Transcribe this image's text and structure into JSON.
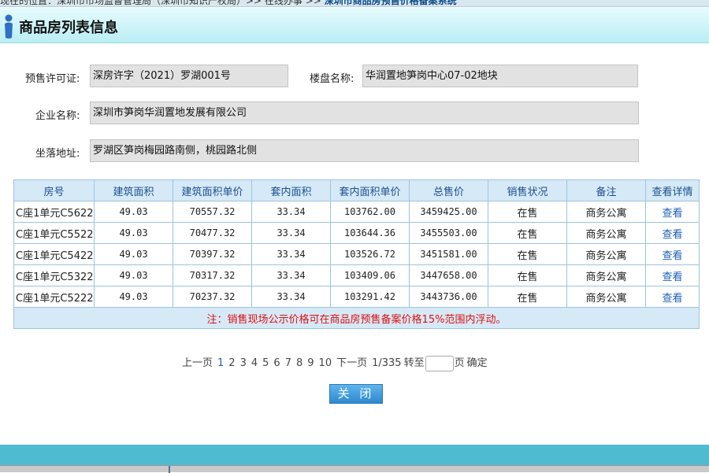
{
  "breadcrumb": {
    "prefix": "现在的位置：深圳市市场监督管理局（深圳市知识产权局）>> 在线办事 >> ",
    "current": "深圳市商品房预售价格备案系统"
  },
  "header": {
    "title": "商品房列表信息"
  },
  "form": {
    "permit_label": "预售许可证:",
    "permit_value": "深房许字（2021）罗湖001号",
    "project_label": "楼盘名称:",
    "project_value": "华润置地笋岗中心07-02地块",
    "company_label": "企业名称:",
    "company_value": "深圳市笋岗华润置地发展有限公司",
    "address_label": "坐落地址:",
    "address_value": "罗湖区笋岗梅园路南侧，桃园路北侧"
  },
  "table": {
    "columns": [
      "房号",
      "建筑面积",
      "建筑面积单价",
      "套内面积",
      "套内面积单价",
      "总售价",
      "销售状况",
      "备注",
      "查看详情"
    ],
    "rows": [
      [
        "C座1单元C5622",
        "49.03",
        "70557.32",
        "33.34",
        "103762.00",
        "3459425.00",
        "在售",
        "商务公寓",
        "查看"
      ],
      [
        "C座1单元C5522",
        "49.03",
        "70477.32",
        "33.34",
        "103644.36",
        "3455503.00",
        "在售",
        "商务公寓",
        "查看"
      ],
      [
        "C座1单元C5422",
        "49.03",
        "70397.32",
        "33.34",
        "103526.72",
        "3451581.00",
        "在售",
        "商务公寓",
        "查看"
      ],
      [
        "C座1单元C5322",
        "49.03",
        "70317.32",
        "33.34",
        "103409.06",
        "3447658.00",
        "在售",
        "商务公寓",
        "查看"
      ],
      [
        "C座1单元C5222",
        "49.03",
        "70237.32",
        "33.34",
        "103291.42",
        "3443736.00",
        "在售",
        "商务公寓",
        "查看"
      ]
    ],
    "note": "注：销售现场公示价格可在商品房预售备案价格15%范围内浮动。"
  },
  "pagination": {
    "prev": "上一页",
    "pages": [
      "1",
      "2",
      "3",
      "4",
      "5",
      "6",
      "7",
      "8",
      "9",
      "10"
    ],
    "current_page": "1",
    "next": "下一页",
    "page_count": "1/335",
    "goto_label": "转至",
    "goto_value": "",
    "page_suffix": "页",
    "confirm": "确定"
  },
  "actions": {
    "close_label": "关 闭"
  },
  "colors": {
    "title_bar": "#b9eef4",
    "table_header": "#d6e9f6",
    "link": "#1a5fb4",
    "note_text": "#dd1111",
    "footer": "#4fbbd0",
    "button": "#2d88cf"
  }
}
